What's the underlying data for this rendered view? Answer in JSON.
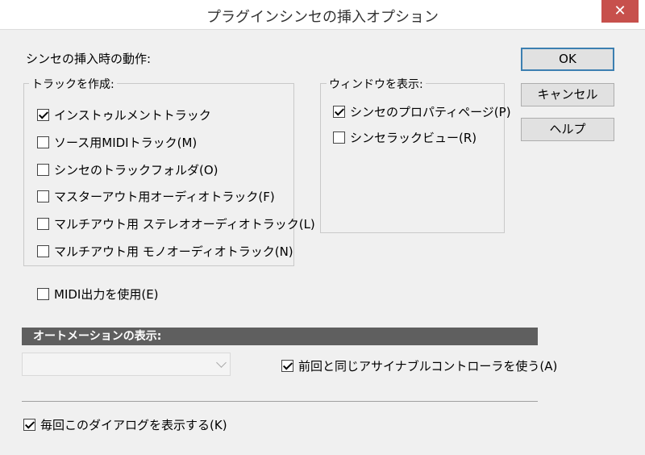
{
  "window": {
    "title": "プラグインシンセの挿入オプション",
    "close_label": "✕"
  },
  "main": {
    "behavior_label": "シンセの挿入時の動作:",
    "create_tracks": {
      "label": "トラックを作成:",
      "items": [
        {
          "label": "インストゥルメントトラック",
          "checked": true
        },
        {
          "label": "ソース用MIDIトラック(M)",
          "checked": false
        },
        {
          "label": "シンセのトラックフォルダ(O)",
          "checked": false
        },
        {
          "label": "マスターアウト用オーディオトラック(F)",
          "checked": false
        },
        {
          "label": "マルチアウト用 ステレオオーディオトラック(L)",
          "checked": false
        },
        {
          "label": "マルチアウト用 モノオーディオトラック(N)",
          "checked": false
        }
      ]
    },
    "show_windows": {
      "label": "ウィンドウを表示:",
      "items": [
        {
          "label": "シンセのプロパティページ(P)",
          "checked": true
        },
        {
          "label": "シンセラックビュー(R)",
          "checked": false
        }
      ]
    },
    "midi_output": {
      "label": "MIDI出力を使用(E)",
      "checked": false
    },
    "automation": {
      "header": "オートメーションの表示:",
      "combo_value": "",
      "same_controller": {
        "label": "前回と同じアサイナブルコントローラを使う(A)",
        "checked": true
      }
    },
    "show_dialog": {
      "label": "毎回このダイアログを表示する(K)",
      "checked": true
    }
  },
  "buttons": {
    "ok": "OK",
    "cancel": "キャンセル",
    "help": "ヘルプ"
  }
}
